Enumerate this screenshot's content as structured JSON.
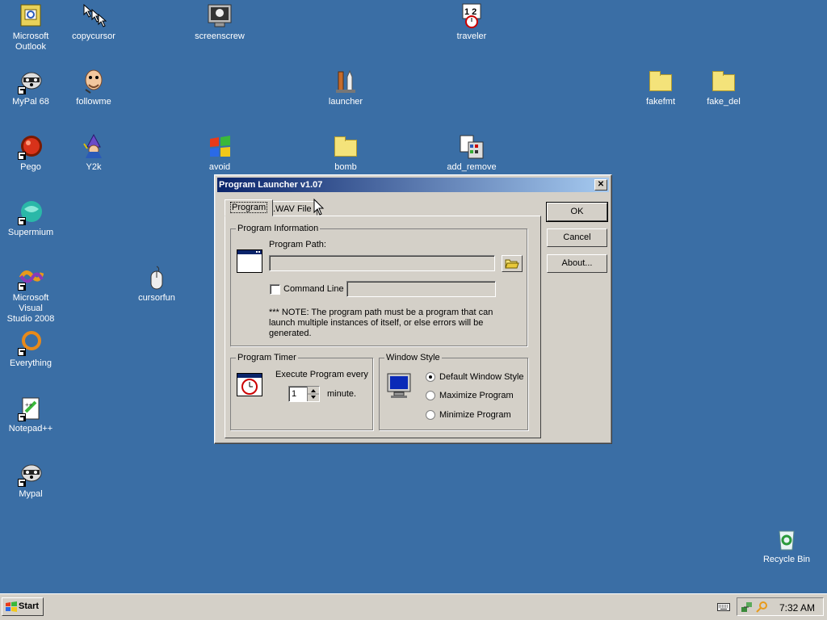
{
  "desktop": {
    "icons": [
      {
        "label_1": "Microsoft",
        "label_2": "Outlook"
      },
      {
        "label": "copycursor"
      },
      {
        "label": "screenscrew"
      },
      {
        "label": "traveler"
      },
      {
        "label": "MyPal 68"
      },
      {
        "label": "followme"
      },
      {
        "label": "launcher"
      },
      {
        "label": "fakefmt"
      },
      {
        "label": "fake_del"
      },
      {
        "label": "Pego"
      },
      {
        "label": "Y2k"
      },
      {
        "label": "avoid"
      },
      {
        "label": "bomb"
      },
      {
        "label": "add_remove"
      },
      {
        "label": "Supermium"
      },
      {
        "label_1": "Microsoft Visual",
        "label_2": "Studio 2008"
      },
      {
        "label": "cursorfun"
      },
      {
        "label": "Everything"
      },
      {
        "label": "Notepad++"
      },
      {
        "label": "Mypal"
      },
      {
        "label": "Recycle Bin"
      }
    ]
  },
  "dialog": {
    "title": "Program Launcher v1.07",
    "close_glyph": "✕",
    "tabs": [
      {
        "label": "Program",
        "active": true
      },
      {
        "label": ".WAV File",
        "active": false
      }
    ],
    "buttons": {
      "ok": "OK",
      "cancel": "Cancel",
      "about": "About..."
    },
    "program_info": {
      "title": "Program Information",
      "path_label": "Program Path:",
      "path_value": "",
      "command_line_label": "Command Line",
      "command_line_checked": false,
      "command_line_value": "",
      "note_line_1": "*** NOTE: The program path must be a program that can",
      "note_line_2": "launch multiple instances of itself, or else errors will be",
      "note_line_3": "generated."
    },
    "program_timer": {
      "title": "Program Timer",
      "execute_label": "Execute Program every",
      "interval_value": "1",
      "unit_label": "minute."
    },
    "window_style": {
      "title": "Window Style",
      "options": [
        {
          "label": "Default Window Style",
          "selected": true
        },
        {
          "label": "Maximize Program",
          "selected": false
        },
        {
          "label": "Minimize Program",
          "selected": false
        }
      ]
    }
  },
  "taskbar": {
    "start_label": "Start",
    "clock": "7:32 AM"
  }
}
